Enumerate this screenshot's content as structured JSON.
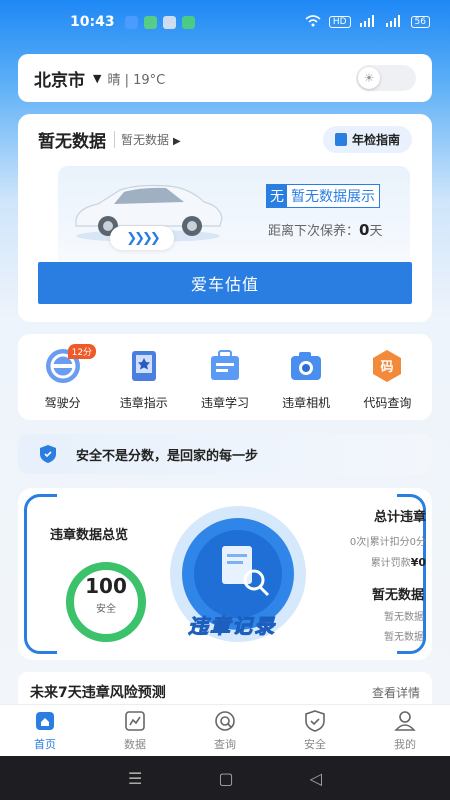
{
  "status_bar": {
    "time": "10:43",
    "hd": "HD",
    "signal": "5G",
    "battery": "56"
  },
  "location": {
    "city": "北京市",
    "weather": "晴 | 19°C"
  },
  "car": {
    "title": "暂无数据",
    "subtitle": "暂无数据",
    "guide_label": "年检指南",
    "tag_no": "无",
    "tag_text": "暂无数据展示",
    "maint_prefix": "距离下次保养：",
    "maint_value": "0",
    "maint_unit": "天",
    "value_button": "爱车估值"
  },
  "services": [
    {
      "label": "驾驶分",
      "icon": "steering-wheel-icon",
      "badge": "12分"
    },
    {
      "label": "违章指示",
      "icon": "bookmark-star-icon"
    },
    {
      "label": "违章学习",
      "icon": "bag-doc-icon"
    },
    {
      "label": "违章相机",
      "icon": "camera-icon"
    },
    {
      "label": "代码查询",
      "icon": "code-tag-icon",
      "glyph": "码"
    }
  ],
  "slogan": "安全不是分数，是回家的每一步",
  "violation": {
    "title": "违章数据总览",
    "score": "100",
    "score_label": "安全",
    "score_fraction": 1.0,
    "record_text": "违章记录",
    "total_title": "总计违章",
    "total_line1": "0次|累计扣分0分",
    "total_line2_prefix": "累计罚款",
    "total_line2_value": "¥0",
    "nd_title": "暂无数据",
    "nd_line1": "暂无数据",
    "nd_line2": "暂无数据"
  },
  "forecast": {
    "title": "未来7天违章风险预测",
    "more": "查看详情"
  },
  "tabs": [
    {
      "label": "首页",
      "icon": "home-icon",
      "active": true
    },
    {
      "label": "数据",
      "icon": "chart-icon"
    },
    {
      "label": "查询",
      "icon": "search-icon"
    },
    {
      "label": "安全",
      "icon": "shield-check-icon"
    },
    {
      "label": "我的",
      "icon": "user-icon"
    }
  ],
  "colors": {
    "primary": "#2a7de1",
    "badge": "#f05a2a",
    "score_green": "#3cc26a"
  }
}
